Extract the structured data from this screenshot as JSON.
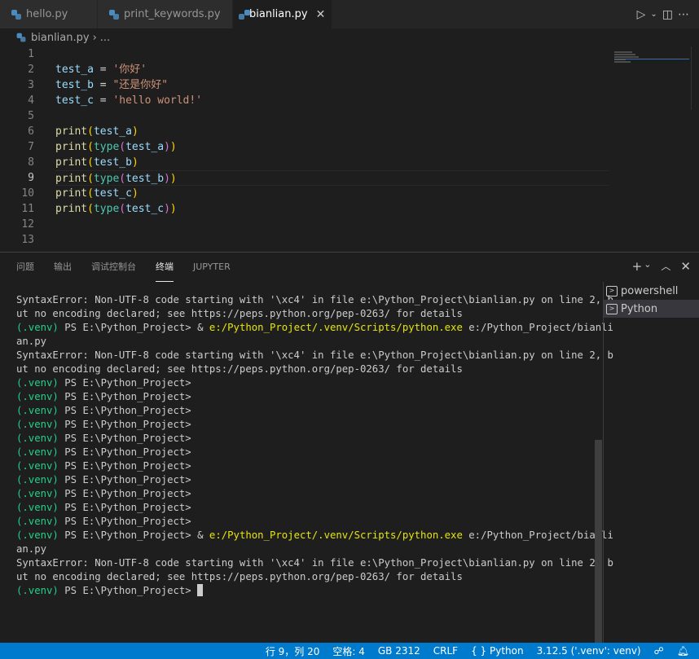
{
  "tabs": [
    {
      "label": "hello.py"
    },
    {
      "label": "print_keywords.py"
    },
    {
      "label": "bianlian.py",
      "active": true
    }
  ],
  "breadcrumb": {
    "file": "bianlian.py",
    "more": "..."
  },
  "editor": {
    "line_numbers": [
      "1",
      "2",
      "3",
      "4",
      "5",
      "6",
      "7",
      "8",
      "9",
      "10",
      "11",
      "12",
      "13"
    ],
    "current_line": 9,
    "code": {
      "l2_var": "test_a",
      "l2_eq": " = ",
      "l2_str": "'你好'",
      "l3_var": "test_b",
      "l3_eq": " = ",
      "l3_str": "\"还是你好\"",
      "l4_var": "test_c",
      "l4_eq": " = ",
      "l4_str": "'hello world!'",
      "print": "print",
      "type": "type",
      "a": "test_a",
      "b": "test_b",
      "c": "test_c"
    }
  },
  "panel": {
    "tabs": [
      "问题",
      "输出",
      "调试控制台",
      "终端",
      "JUPYTER"
    ],
    "active_tab": "终端",
    "terminals": [
      "powershell",
      "Python"
    ],
    "selected_terminal": "Python"
  },
  "terminal": {
    "err1a": "SyntaxError: Non-UTF-8 code starting with '\\xc4' in file e:\\Python_Project\\bianlian.py on line 2, b",
    "err1b": "ut no encoding declared; see https://peps.python.org/pep-0263/ for details",
    "venv": "(.venv)",
    "ps": " PS E:\\Python_Project> ",
    "amp": "& ",
    "cmd": "e:/Python_Project/.venv/Scripts/python.exe",
    "arg": " e:/Python_Project/bianli",
    "arg2": "an.py"
  },
  "status": {
    "position": "行 9，列 20",
    "spaces": "空格: 4",
    "encoding": "GB 2312",
    "eol": "CRLF",
    "language": "Python",
    "interpreter": "3.12.5 ('.venv': venv)"
  }
}
